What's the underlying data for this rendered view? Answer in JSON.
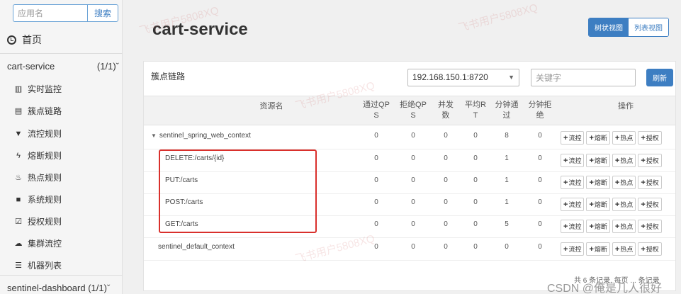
{
  "sidebar": {
    "search": {
      "placeholder": "应用名",
      "button": "搜索"
    },
    "home": "首页",
    "app": {
      "name": "cart-service",
      "count": "(1/1)",
      "chevron": "chevron-down-icon"
    },
    "menu": [
      {
        "label": "实时监控",
        "icon": "bar-chart-icon"
      },
      {
        "label": "簇点链路",
        "icon": "list-icon"
      },
      {
        "label": "流控规则",
        "icon": "filter-icon"
      },
      {
        "label": "熔断规则",
        "icon": "bolt-icon"
      },
      {
        "label": "热点规则",
        "icon": "fire-icon"
      },
      {
        "label": "系统规则",
        "icon": "lock-icon"
      },
      {
        "label": "授权规则",
        "icon": "check-square-icon"
      },
      {
        "label": "集群流控",
        "icon": "cloud-icon"
      },
      {
        "label": "机器列表",
        "icon": "table-icon"
      }
    ],
    "app2": {
      "name": "sentinel-dashboard",
      "count": "(1/1)"
    }
  },
  "header": {
    "title": "cart-service",
    "views": [
      "树状视图",
      "列表视图"
    ]
  },
  "panel": {
    "title": "簇点链路",
    "machine": "192.168.150.1:8720",
    "keyword_placeholder": "关键字",
    "refresh": "刷新"
  },
  "table": {
    "columns": [
      "资源名",
      "通过QPS",
      "拒绝QPS",
      "并发数",
      "平均RT",
      "分钟通过",
      "分钟拒绝",
      "操作"
    ],
    "column_lines": [
      [
        "资源名"
      ],
      [
        "通过QP",
        "S"
      ],
      [
        "拒绝QP",
        "S"
      ],
      [
        "并发",
        "数"
      ],
      [
        "平均R",
        "T"
      ],
      [
        "分钟通",
        "过"
      ],
      [
        "分钟拒",
        "绝"
      ],
      [
        "操作"
      ]
    ],
    "rows": [
      {
        "name": "sentinel_spring_web_context",
        "vals": [
          "0",
          "0",
          "0",
          "0",
          "8",
          "0"
        ]
      },
      {
        "name": "DELETE:/carts/{id}",
        "vals": [
          "0",
          "0",
          "0",
          "0",
          "1",
          "0"
        ]
      },
      {
        "name": "PUT:/carts",
        "vals": [
          "0",
          "0",
          "0",
          "0",
          "1",
          "0"
        ]
      },
      {
        "name": "POST:/carts",
        "vals": [
          "0",
          "0",
          "0",
          "0",
          "1",
          "0"
        ]
      },
      {
        "name": "GET:/carts",
        "vals": [
          "0",
          "0",
          "0",
          "0",
          "5",
          "0"
        ]
      },
      {
        "name": "sentinel_default_context",
        "vals": [
          "0",
          "0",
          "0",
          "0",
          "0",
          "0"
        ]
      }
    ],
    "op_labels": [
      "流控",
      "熔断",
      "热点",
      "授权"
    ]
  },
  "pager": "共 6 条记录, 每页 ... 条记录",
  "watermark": "CSDN @俺是几人很好"
}
